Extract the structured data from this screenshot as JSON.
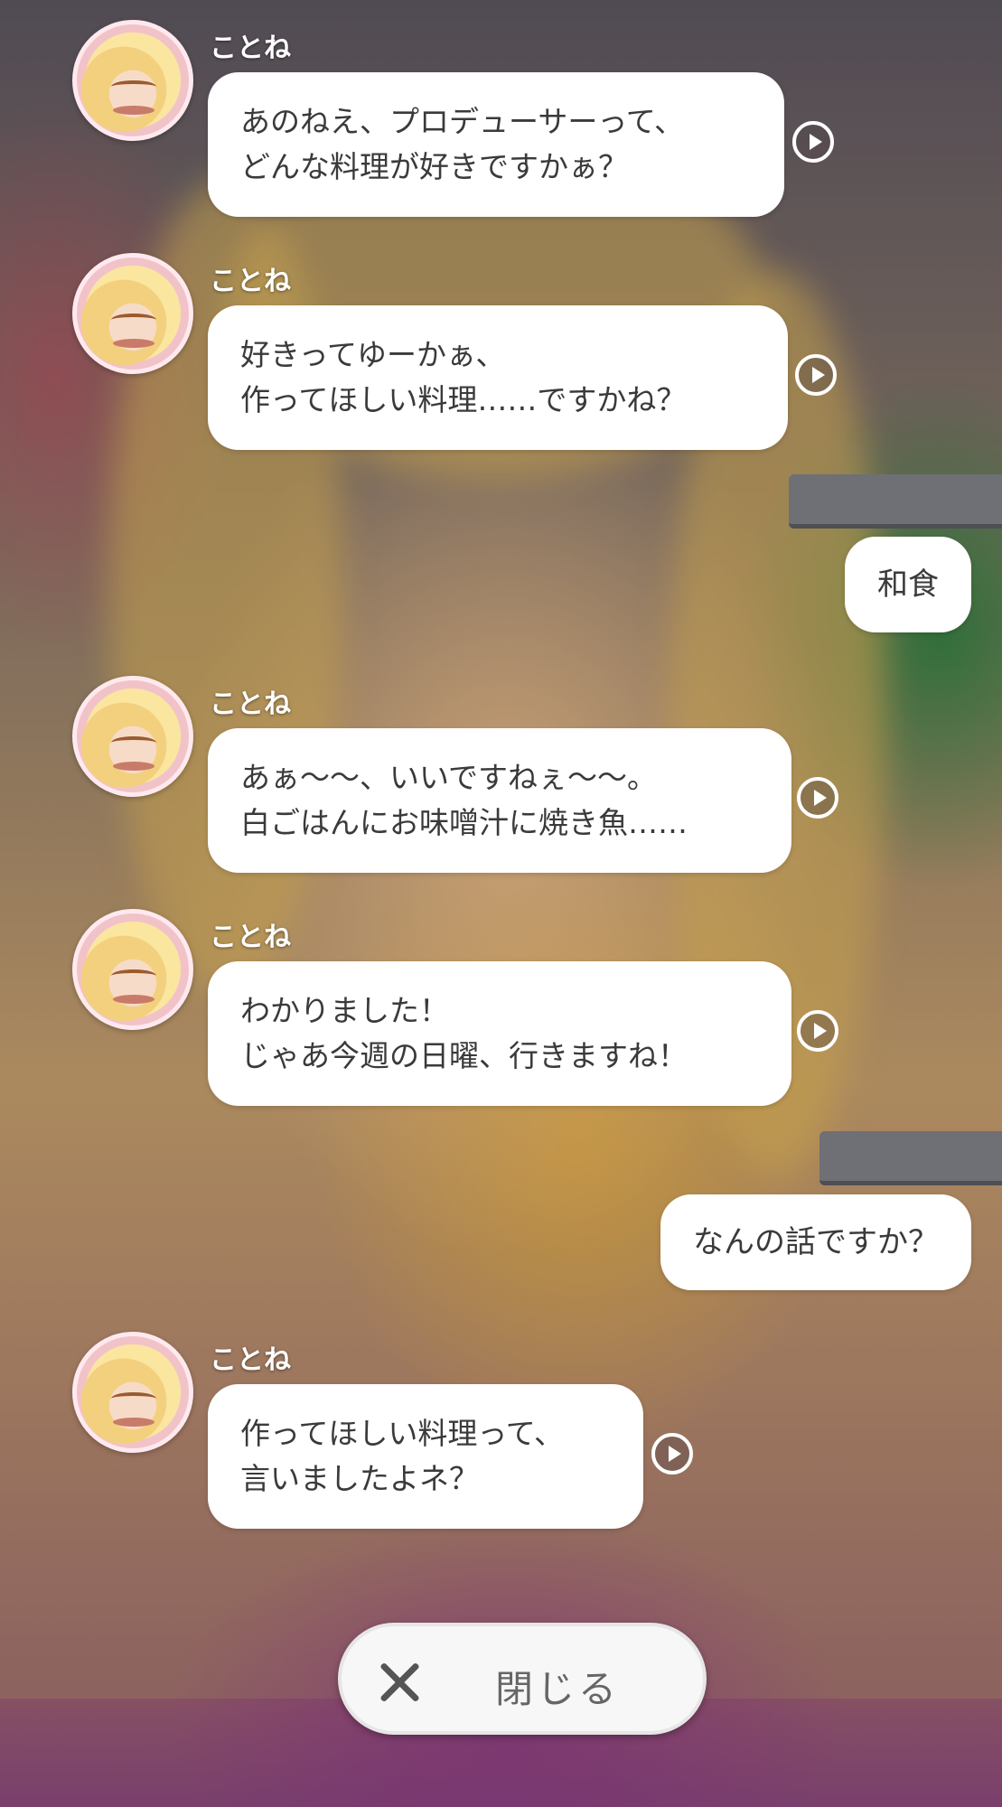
{
  "speaker_name": "ことね",
  "messages": [
    {
      "line1": "あのねえ、プロデューサーって、",
      "line2": "どんな料理が好きですかぁ？"
    },
    {
      "line1": "好きってゆーかぁ、",
      "line2": "作ってほしい料理……ですかね？"
    },
    {
      "line1": "あぁ～～、いいですねぇ～～。",
      "line2": "白ごはんにお味噌汁に焼き魚……"
    },
    {
      "line1": "わかりました！",
      "line2": "じゃあ今週の日曜、行きますね！"
    },
    {
      "line1": "作ってほしい料理って、",
      "line2": "言いましたよネ？"
    }
  ],
  "replies": [
    "和食",
    "なんの話ですか？"
  ],
  "close_button": {
    "label": "閉じる"
  },
  "icons": {
    "play": "play-voice-icon",
    "close": "close-icon",
    "avatar": "kotone-avatar"
  }
}
